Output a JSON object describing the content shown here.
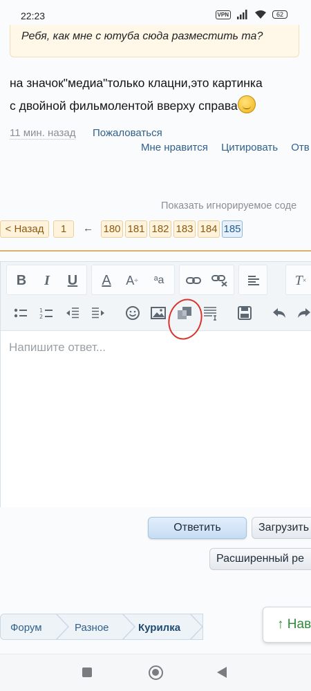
{
  "status_bar": {
    "time": "22:23",
    "vpn": "VPN",
    "battery": "62"
  },
  "quote": {
    "text": "Ребя, как мне с ютуба сюда разместить та?"
  },
  "post": {
    "line1": "на значок\"медиа\"только клацни,это картинка",
    "line2": "с двойной фильмолентой вверху справа",
    "time_ago": "11 мин. назад",
    "report": "Пожаловаться",
    "actions": [
      "Мне нравится",
      "Цитировать",
      "Отв"
    ]
  },
  "show_ignored": "Показать игнорируемое соде",
  "pagination": {
    "back": "< Назад",
    "first": "1",
    "ellipsis_arrow": "←",
    "pages": [
      "180",
      "181",
      "182",
      "183",
      "184",
      "185"
    ],
    "current": "185"
  },
  "editor": {
    "placeholder": "Напишите ответ...",
    "toolbar_row1": [
      "bold-icon",
      "italic-icon",
      "underline-icon",
      "text-color-icon",
      "font-size-icon",
      "font-family-icon",
      "link-icon",
      "unlink-icon",
      "align-icon",
      "remove-format-icon"
    ],
    "toolbar_row2": [
      "bullet-list-icon",
      "numbered-list-icon",
      "outdent-icon",
      "indent-icon",
      "smilies-icon",
      "image-icon",
      "media-icon",
      "quote-insert-icon",
      "save-draft-icon",
      "undo-icon",
      "redo-icon"
    ]
  },
  "buttons": {
    "reply": "Ответить",
    "upload": "Загрузить",
    "advanced": "Расширенный ре"
  },
  "breadcrumb": [
    "Форум",
    "Разное",
    "Курилка"
  ],
  "go_top": "↑ Нав",
  "colors": {
    "link": "#2f5f8a",
    "accent_orange": "#d9b06a",
    "annotation_red": "#d9322b"
  }
}
